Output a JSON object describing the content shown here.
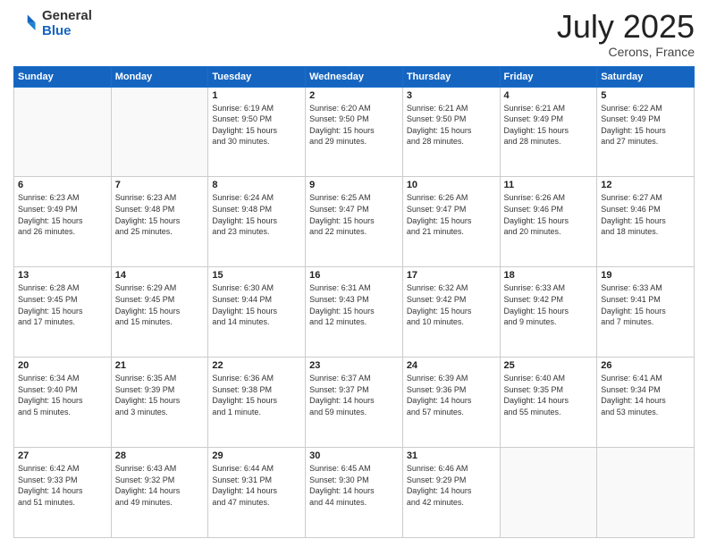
{
  "header": {
    "logo_general": "General",
    "logo_blue": "Blue",
    "month_title": "July 2025",
    "location": "Cerons, France"
  },
  "weekdays": [
    "Sunday",
    "Monday",
    "Tuesday",
    "Wednesday",
    "Thursday",
    "Friday",
    "Saturday"
  ],
  "weeks": [
    [
      {
        "day": "",
        "info": ""
      },
      {
        "day": "",
        "info": ""
      },
      {
        "day": "1",
        "info": "Sunrise: 6:19 AM\nSunset: 9:50 PM\nDaylight: 15 hours\nand 30 minutes."
      },
      {
        "day": "2",
        "info": "Sunrise: 6:20 AM\nSunset: 9:50 PM\nDaylight: 15 hours\nand 29 minutes."
      },
      {
        "day": "3",
        "info": "Sunrise: 6:21 AM\nSunset: 9:50 PM\nDaylight: 15 hours\nand 28 minutes."
      },
      {
        "day": "4",
        "info": "Sunrise: 6:21 AM\nSunset: 9:49 PM\nDaylight: 15 hours\nand 28 minutes."
      },
      {
        "day": "5",
        "info": "Sunrise: 6:22 AM\nSunset: 9:49 PM\nDaylight: 15 hours\nand 27 minutes."
      }
    ],
    [
      {
        "day": "6",
        "info": "Sunrise: 6:23 AM\nSunset: 9:49 PM\nDaylight: 15 hours\nand 26 minutes."
      },
      {
        "day": "7",
        "info": "Sunrise: 6:23 AM\nSunset: 9:48 PM\nDaylight: 15 hours\nand 25 minutes."
      },
      {
        "day": "8",
        "info": "Sunrise: 6:24 AM\nSunset: 9:48 PM\nDaylight: 15 hours\nand 23 minutes."
      },
      {
        "day": "9",
        "info": "Sunrise: 6:25 AM\nSunset: 9:47 PM\nDaylight: 15 hours\nand 22 minutes."
      },
      {
        "day": "10",
        "info": "Sunrise: 6:26 AM\nSunset: 9:47 PM\nDaylight: 15 hours\nand 21 minutes."
      },
      {
        "day": "11",
        "info": "Sunrise: 6:26 AM\nSunset: 9:46 PM\nDaylight: 15 hours\nand 20 minutes."
      },
      {
        "day": "12",
        "info": "Sunrise: 6:27 AM\nSunset: 9:46 PM\nDaylight: 15 hours\nand 18 minutes."
      }
    ],
    [
      {
        "day": "13",
        "info": "Sunrise: 6:28 AM\nSunset: 9:45 PM\nDaylight: 15 hours\nand 17 minutes."
      },
      {
        "day": "14",
        "info": "Sunrise: 6:29 AM\nSunset: 9:45 PM\nDaylight: 15 hours\nand 15 minutes."
      },
      {
        "day": "15",
        "info": "Sunrise: 6:30 AM\nSunset: 9:44 PM\nDaylight: 15 hours\nand 14 minutes."
      },
      {
        "day": "16",
        "info": "Sunrise: 6:31 AM\nSunset: 9:43 PM\nDaylight: 15 hours\nand 12 minutes."
      },
      {
        "day": "17",
        "info": "Sunrise: 6:32 AM\nSunset: 9:42 PM\nDaylight: 15 hours\nand 10 minutes."
      },
      {
        "day": "18",
        "info": "Sunrise: 6:33 AM\nSunset: 9:42 PM\nDaylight: 15 hours\nand 9 minutes."
      },
      {
        "day": "19",
        "info": "Sunrise: 6:33 AM\nSunset: 9:41 PM\nDaylight: 15 hours\nand 7 minutes."
      }
    ],
    [
      {
        "day": "20",
        "info": "Sunrise: 6:34 AM\nSunset: 9:40 PM\nDaylight: 15 hours\nand 5 minutes."
      },
      {
        "day": "21",
        "info": "Sunrise: 6:35 AM\nSunset: 9:39 PM\nDaylight: 15 hours\nand 3 minutes."
      },
      {
        "day": "22",
        "info": "Sunrise: 6:36 AM\nSunset: 9:38 PM\nDaylight: 15 hours\nand 1 minute."
      },
      {
        "day": "23",
        "info": "Sunrise: 6:37 AM\nSunset: 9:37 PM\nDaylight: 14 hours\nand 59 minutes."
      },
      {
        "day": "24",
        "info": "Sunrise: 6:39 AM\nSunset: 9:36 PM\nDaylight: 14 hours\nand 57 minutes."
      },
      {
        "day": "25",
        "info": "Sunrise: 6:40 AM\nSunset: 9:35 PM\nDaylight: 14 hours\nand 55 minutes."
      },
      {
        "day": "26",
        "info": "Sunrise: 6:41 AM\nSunset: 9:34 PM\nDaylight: 14 hours\nand 53 minutes."
      }
    ],
    [
      {
        "day": "27",
        "info": "Sunrise: 6:42 AM\nSunset: 9:33 PM\nDaylight: 14 hours\nand 51 minutes."
      },
      {
        "day": "28",
        "info": "Sunrise: 6:43 AM\nSunset: 9:32 PM\nDaylight: 14 hours\nand 49 minutes."
      },
      {
        "day": "29",
        "info": "Sunrise: 6:44 AM\nSunset: 9:31 PM\nDaylight: 14 hours\nand 47 minutes."
      },
      {
        "day": "30",
        "info": "Sunrise: 6:45 AM\nSunset: 9:30 PM\nDaylight: 14 hours\nand 44 minutes."
      },
      {
        "day": "31",
        "info": "Sunrise: 6:46 AM\nSunset: 9:29 PM\nDaylight: 14 hours\nand 42 minutes."
      },
      {
        "day": "",
        "info": ""
      },
      {
        "day": "",
        "info": ""
      }
    ]
  ]
}
